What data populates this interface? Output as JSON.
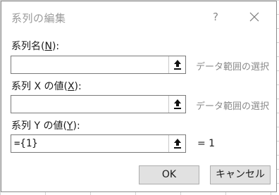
{
  "dialog": {
    "title": "系列の編集",
    "help_label": "?",
    "close_icon": "close-icon"
  },
  "fields": [
    {
      "label_prefix": "系列名(",
      "label_key": "N",
      "label_suffix": "):",
      "value": "",
      "hint": "データ範囲の選択"
    },
    {
      "label_prefix": "系列 X の値(",
      "label_key": "X",
      "label_suffix": "):",
      "value": "",
      "hint": "データ範囲の選択"
    },
    {
      "label_prefix": "系列 Y の値(",
      "label_key": "Y",
      "label_suffix": "):",
      "value": "={1}",
      "result": "= 1"
    }
  ],
  "buttons": {
    "ok": "OK",
    "cancel": "キャンセル"
  },
  "icons": {
    "range_select": "range-select-icon"
  },
  "colors": {
    "title_text": "#9a9a9a",
    "hint_text": "#8a8a8a",
    "button_bg": "#e1e1e1",
    "border": "#7a7a7a"
  }
}
